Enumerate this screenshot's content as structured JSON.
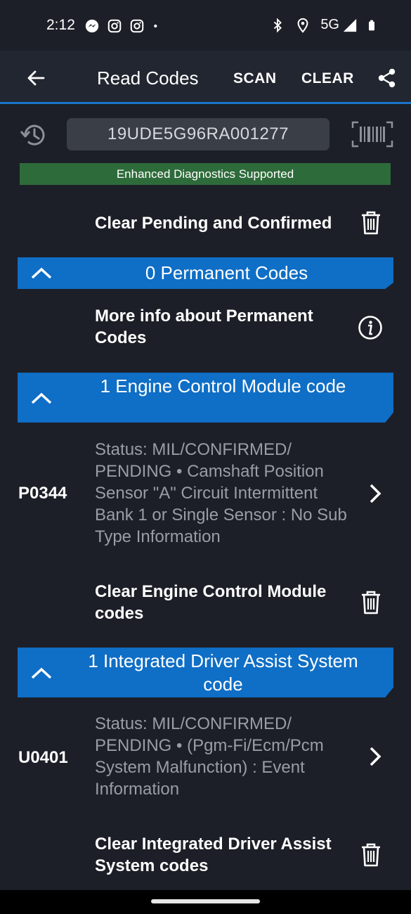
{
  "status_bar": {
    "time": "2:12",
    "left_icons": [
      "messenger-icon",
      "instagram-icon",
      "instagram-icon",
      "dot-icon"
    ],
    "network": "5G",
    "right_icons": [
      "bluetooth-icon",
      "location-icon",
      "signal-icon",
      "battery-icon"
    ]
  },
  "app_bar": {
    "title": "Read Codes",
    "scan_label": "SCAN",
    "clear_label": "CLEAR",
    "back_icon": "arrow-left-icon",
    "share_icon": "share-icon"
  },
  "vin": {
    "value": "19UDE5G96RA001277",
    "history_icon": "history-icon",
    "barcode_icon": "barcode-scan-icon"
  },
  "enhanced_banner": "Enhanced Diagnostics Supported",
  "clear_all_label": "Clear Pending and Confirmed",
  "sections": [
    {
      "title": "0 Permanent Codes",
      "info_label": "More info about Permanent Codes"
    },
    {
      "title": "1 Engine Control Module code",
      "codes": [
        {
          "id": "P0344",
          "description": "Status: MIL/CONFIRMED/ PENDING • Camshaft Position Sensor \"A\" Circuit Intermittent Bank 1 or Single Sensor : No Sub Type Information"
        }
      ],
      "clear_label": "Clear Engine Control Module codes"
    },
    {
      "title": "1 Integrated Driver Assist System code",
      "codes": [
        {
          "id": "U0401",
          "description": "Status: MIL/CONFIRMED/ PENDING • (Pgm-Fi/Ecm/Pcm System Malfunction) : Event Information"
        }
      ],
      "clear_label": "Clear Integrated Driver Assist System codes"
    }
  ],
  "colors": {
    "background": "#1c1f27",
    "app_bar": "#222630",
    "accent_blue": "#0f6ec5",
    "enhanced_green": "#2e6b3a",
    "secondary_text": "#9a9da3"
  }
}
